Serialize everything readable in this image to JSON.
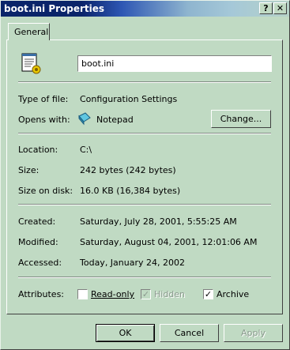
{
  "window": {
    "title": "boot.ini Properties",
    "help_button": "?",
    "close_button": "✕"
  },
  "tabs": [
    {
      "label": "General"
    }
  ],
  "file": {
    "name": "boot.ini"
  },
  "type": {
    "label": "Type of file:",
    "value": "Configuration Settings"
  },
  "opens_with": {
    "label": "Opens with:",
    "value": "Notepad",
    "change_button": "Change..."
  },
  "location": {
    "label": "Location:",
    "value": "C:\\"
  },
  "size": {
    "label": "Size:",
    "value": "242 bytes (242 bytes)"
  },
  "size_on_disk": {
    "label": "Size on disk:",
    "value": "16.0 KB (16,384 bytes)"
  },
  "created": {
    "label": "Created:",
    "value": "Saturday, July 28, 2001, 5:55:25 AM"
  },
  "modified": {
    "label": "Modified:",
    "value": "Saturday, August 04, 2001, 12:01:06 AM"
  },
  "accessed": {
    "label": "Accessed:",
    "value": "Today, January 24, 2002"
  },
  "attributes": {
    "label": "Attributes:",
    "readonly": {
      "label": "Read-only",
      "checked": false
    },
    "hidden": {
      "label": "Hidden",
      "checked": true,
      "disabled": true
    },
    "archive": {
      "label": "Archive",
      "checked": true
    }
  },
  "buttons": {
    "ok": "OK",
    "cancel": "Cancel",
    "apply": "Apply"
  },
  "icons": {
    "file_icon": "notepad-file-icon",
    "app_icon": "notepad-icon"
  }
}
